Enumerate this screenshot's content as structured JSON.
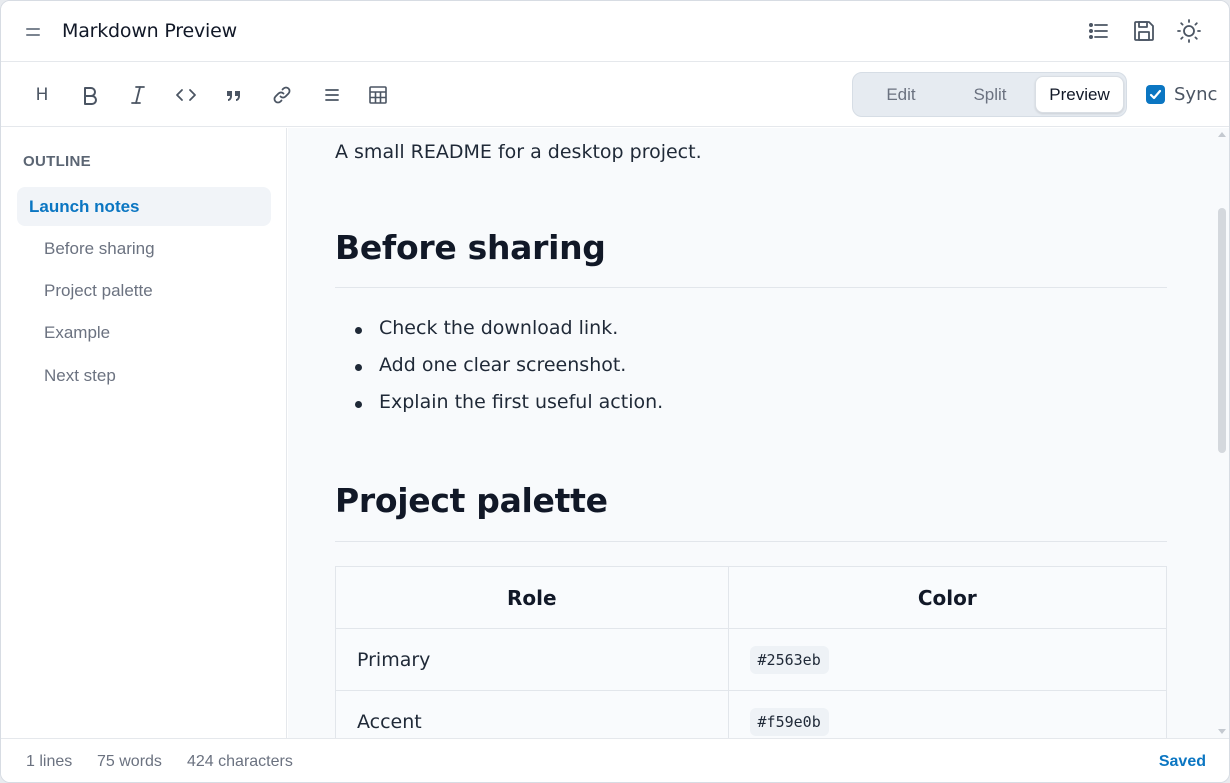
{
  "app": {
    "title": "Markdown Preview",
    "icons": [
      "menu-icon",
      "outline-list-icon",
      "save-icon",
      "theme-sun-icon"
    ]
  },
  "toolbar": {
    "heading_label": "H",
    "buttons": [
      "heading-icon",
      "bold-icon",
      "italic-icon",
      "code-icon",
      "quote-icon",
      "link-icon",
      "list-icon",
      "table-icon"
    ],
    "view_modes": [
      "Edit",
      "Split",
      "Preview"
    ],
    "active_view": "Preview",
    "sync_label": "Sync",
    "sync_checked": true
  },
  "sidebar": {
    "heading": "OUTLINE",
    "items": [
      {
        "label": "Launch notes",
        "level": 1,
        "active": true
      },
      {
        "label": "Before sharing",
        "level": 2,
        "active": false
      },
      {
        "label": "Project palette",
        "level": 2,
        "active": false
      },
      {
        "label": "Example",
        "level": 2,
        "active": false
      },
      {
        "label": "Next step",
        "level": 2,
        "active": false
      }
    ]
  },
  "preview": {
    "intro": "A small README for a desktop project.",
    "sections": [
      {
        "heading": "Before sharing",
        "items": [
          "Check the download link.",
          "Add one clear screenshot.",
          "Explain the first useful action."
        ]
      },
      {
        "heading": "Project palette",
        "table": {
          "headers": [
            "Role",
            "Color"
          ],
          "rows": [
            [
              "Primary",
              "#2563eb"
            ],
            [
              "Accent",
              "#f59e0b"
            ]
          ]
        }
      }
    ]
  },
  "status": {
    "lines": "1 lines",
    "words": "75 words",
    "characters": "424 characters",
    "saved": "Saved"
  },
  "colors": {
    "accent": "#0b76c2",
    "background": "#f8fafc"
  }
}
